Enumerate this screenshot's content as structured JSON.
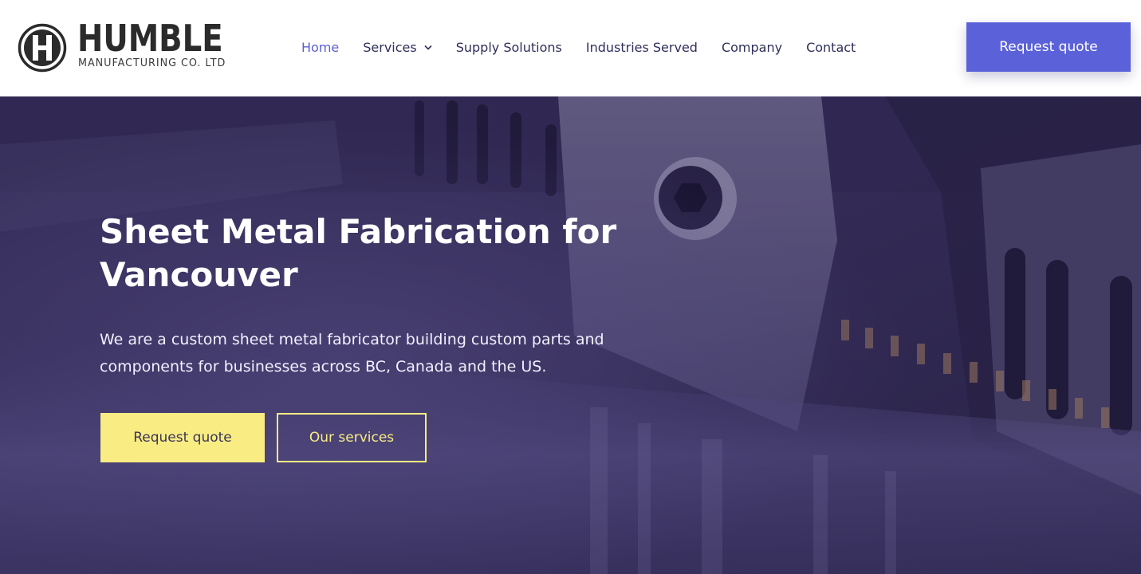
{
  "brand": {
    "name": "HUMBLE",
    "tagline": "MANUFACTURING CO. LTD",
    "logo_letter": "H",
    "color_dark": "#2b2b2b"
  },
  "nav": {
    "items": [
      {
        "label": "Home",
        "active": true
      },
      {
        "label": "Services",
        "has_dropdown": true,
        "icon": "chevron-down-icon"
      },
      {
        "label": "Supply Solutions"
      },
      {
        "label": "Industries Served"
      },
      {
        "label": "Company"
      },
      {
        "label": "Contact"
      }
    ],
    "active_color": "#5a5fcf",
    "text_color": "#2f2f5c"
  },
  "header_cta": {
    "label": "Request quote",
    "color": "#5b62d9"
  },
  "hero": {
    "title": "Sheet Metal Fabrication for Vancouver",
    "description": "We are a custom sheet metal fabricator building custom parts and components for businesses across BC, Canada and the US.",
    "primary_button": {
      "label": "Request quote",
      "color": "#f8ec83"
    },
    "secondary_button": {
      "label": "Our services",
      "color": "#f8ec83"
    },
    "overlay_color": "#2c2550"
  }
}
